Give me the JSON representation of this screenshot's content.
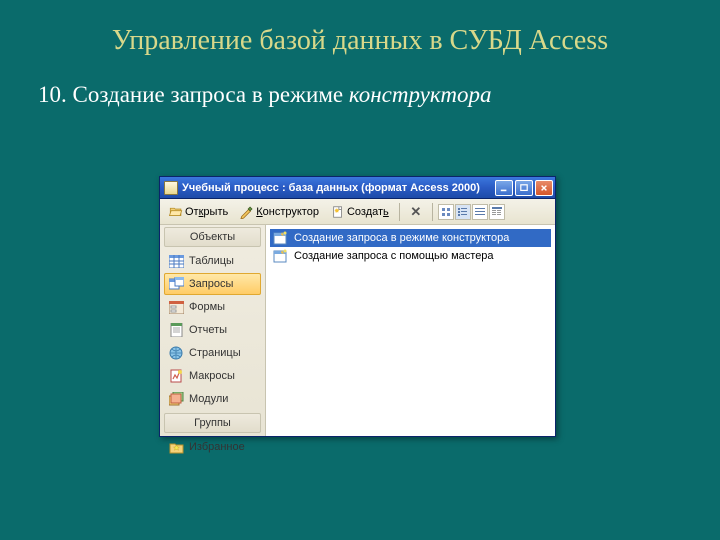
{
  "slide": {
    "title": "Управление базой данных в СУБД Access",
    "subtitle_number": "10.",
    "subtitle_text": "Создание запроса в режиме",
    "subtitle_italic": "конструктора"
  },
  "window": {
    "title": "Учебный процесс : база данных (формат Access 2000)"
  },
  "toolbar": {
    "open_prefix": "От",
    "open_underline": "к",
    "open_suffix": "рыть",
    "design_underline": "К",
    "design_suffix": "онструктор",
    "new_prefix": "Создат",
    "new_underline": "ь"
  },
  "sidebar": {
    "header_objects": "Объекты",
    "items": {
      "tables": "Таблицы",
      "queries": "Запросы",
      "forms": "Формы",
      "reports": "Отчеты",
      "pages": "Страницы",
      "macros": "Макросы",
      "modules": "Модули"
    },
    "header_groups": "Группы",
    "favorites": "Избранное"
  },
  "content": {
    "items": [
      "Создание запроса в режиме конструктора",
      "Создание запроса с помощью мастера"
    ]
  }
}
